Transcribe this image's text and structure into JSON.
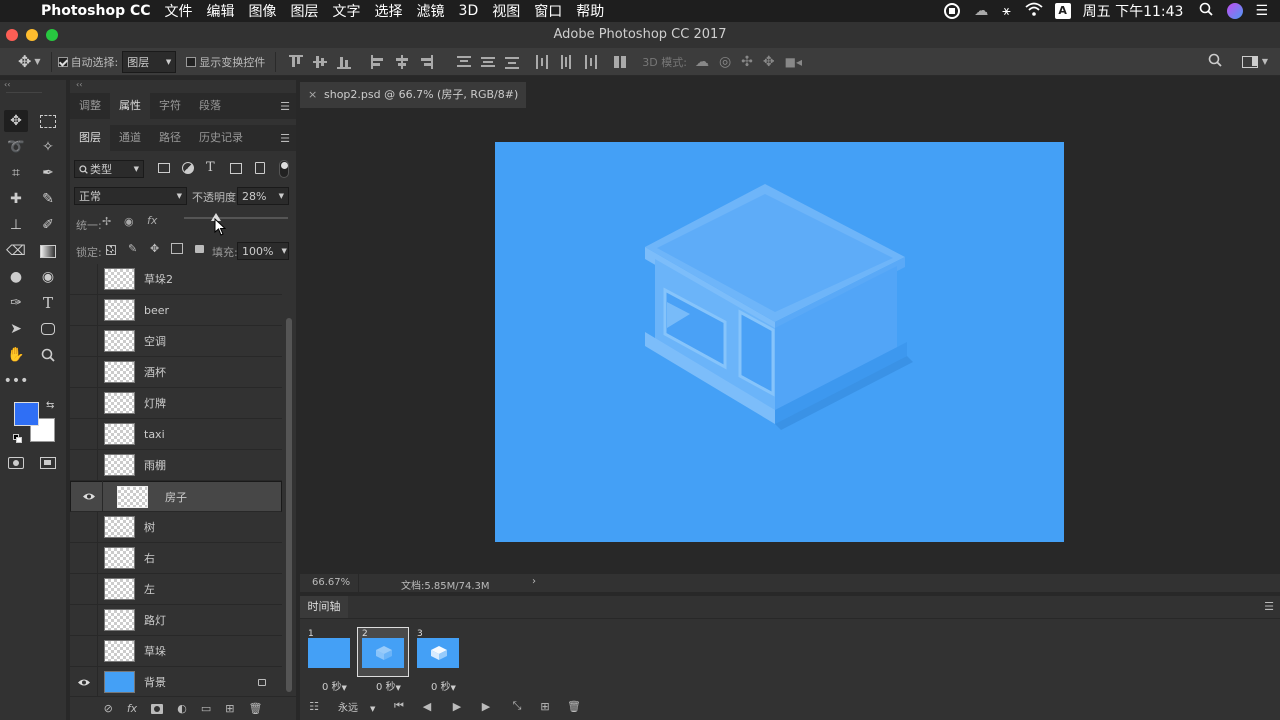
{
  "menubar": {
    "app": "Photoshop CC",
    "items": [
      "文件",
      "编辑",
      "图像",
      "图层",
      "文字",
      "选择",
      "滤镜",
      "3D",
      "视图",
      "窗口",
      "帮助"
    ],
    "clock": "周五 下午11:43",
    "input_method": "A"
  },
  "window": {
    "title": "Adobe Photoshop CC 2017"
  },
  "options": {
    "auto_select_label": "自动选择:",
    "auto_select_value": "图层",
    "show_transform_label": "显示变换控件",
    "mode_3d_label": "3D 模式:"
  },
  "panel_top": {
    "tabs": [
      "调整",
      "属性",
      "字符",
      "段落"
    ],
    "active": 1
  },
  "layers_panel": {
    "tabs": [
      "图层",
      "通道",
      "路径",
      "历史记录"
    ],
    "filter_label": "类型",
    "blend_mode": "正常",
    "opacity_label": "不透明度:",
    "opacity_value": "28%",
    "unify_label": "统一:",
    "lock_label": "锁定:",
    "fill_label": "填充:",
    "fill_value": "100%",
    "layers": [
      {
        "name": "草垛2",
        "visible": false,
        "selected": false
      },
      {
        "name": "beer",
        "visible": false,
        "selected": false
      },
      {
        "name": "空调",
        "visible": false,
        "selected": false
      },
      {
        "name": "酒杯",
        "visible": false,
        "selected": false
      },
      {
        "name": "灯牌",
        "visible": false,
        "selected": false
      },
      {
        "name": "taxi",
        "visible": false,
        "selected": false
      },
      {
        "name": "雨棚",
        "visible": false,
        "selected": false
      },
      {
        "name": "房子",
        "visible": true,
        "selected": true
      },
      {
        "name": "树",
        "visible": false,
        "selected": false
      },
      {
        "name": "右",
        "visible": false,
        "selected": false
      },
      {
        "name": "左",
        "visible": false,
        "selected": false
      },
      {
        "name": "路灯",
        "visible": false,
        "selected": false
      },
      {
        "name": "草垛",
        "visible": false,
        "selected": false
      },
      {
        "name": "背景",
        "visible": true,
        "selected": false,
        "locked": true
      }
    ]
  },
  "document": {
    "tab_label": "shop2.psd @ 66.7% (房子, RGB/8#) *",
    "zoom": "66.67%",
    "doc_info": "文档:5.85M/74.3M",
    "background_color": "#44a0f6"
  },
  "timeline": {
    "title": "时间轴",
    "frames": [
      {
        "num": "1",
        "delay": "0 秒",
        "selected": false
      },
      {
        "num": "2",
        "delay": "0 秒",
        "selected": true
      },
      {
        "num": "3",
        "delay": "0 秒",
        "selected": false
      }
    ],
    "loop": "永远"
  },
  "colors": {
    "foreground": "#2f6ff5",
    "background": "#ffffff"
  }
}
